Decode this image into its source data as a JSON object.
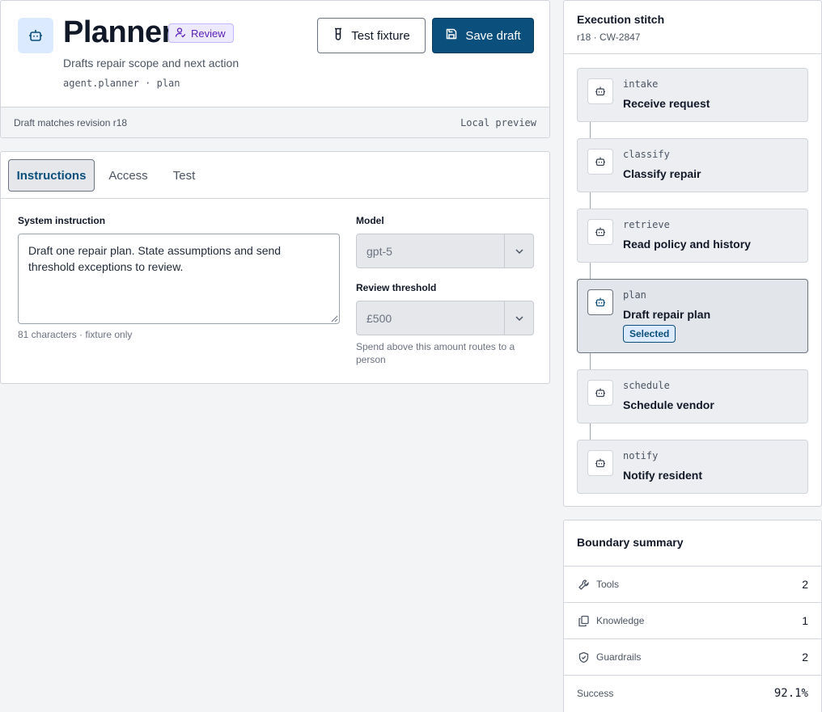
{
  "header": {
    "agent_name": "Planner",
    "badge_label": "Review",
    "description": "Drafts repair scope and next action",
    "agent_id": "agent.planner · plan",
    "test_fixture_label": "Test fixture",
    "save_draft_label": "Save draft",
    "status_left": "Draft matches revision r18",
    "status_right": "Local preview",
    "icons": {
      "avatar": "robot-icon",
      "badge": "user-check-icon",
      "test": "flask-icon",
      "save": "save-icon"
    },
    "colors": {
      "primary": "#0b4f7c",
      "badge_bg": "#ede9fe",
      "badge_text": "#5b21b6",
      "avatar_bg": "#dbeafe"
    }
  },
  "editor": {
    "tabs": [
      {
        "label": "Instructions",
        "active": true
      },
      {
        "label": "Access",
        "active": false
      },
      {
        "label": "Test",
        "active": false
      }
    ],
    "system_instruction_label": "System instruction",
    "system_instruction_value": "Draft one repair plan. State assumptions and send threshold exceptions to review.",
    "instruction_helper": "81 characters · fixture only",
    "model_label": "Model",
    "model_value": "gpt-5",
    "threshold_label": "Review threshold",
    "threshold_value": "£500",
    "threshold_helper": "Spend above this amount routes to a person"
  },
  "stitch": {
    "title": "Execution stitch",
    "subtitle": "r18 · CW-2847",
    "selected_badge": "Selected",
    "steps": [
      {
        "key": "intake",
        "title": "Receive request",
        "selected": false
      },
      {
        "key": "classify",
        "title": "Classify repair",
        "selected": false
      },
      {
        "key": "retrieve",
        "title": "Read policy and history",
        "selected": false
      },
      {
        "key": "plan",
        "title": "Draft repair plan",
        "selected": true
      },
      {
        "key": "schedule",
        "title": "Schedule vendor",
        "selected": false
      },
      {
        "key": "notify",
        "title": "Notify resident",
        "selected": false
      }
    ]
  },
  "boundary": {
    "title": "Boundary summary",
    "rows": [
      {
        "label": "Tools",
        "value": "2",
        "icon": "wrench-icon"
      },
      {
        "label": "Knowledge",
        "value": "1",
        "icon": "documents-icon"
      },
      {
        "label": "Guardrails",
        "value": "2",
        "icon": "shield-check-icon"
      },
      {
        "label": "Success",
        "value": "92.1%",
        "icon": ""
      }
    ]
  }
}
